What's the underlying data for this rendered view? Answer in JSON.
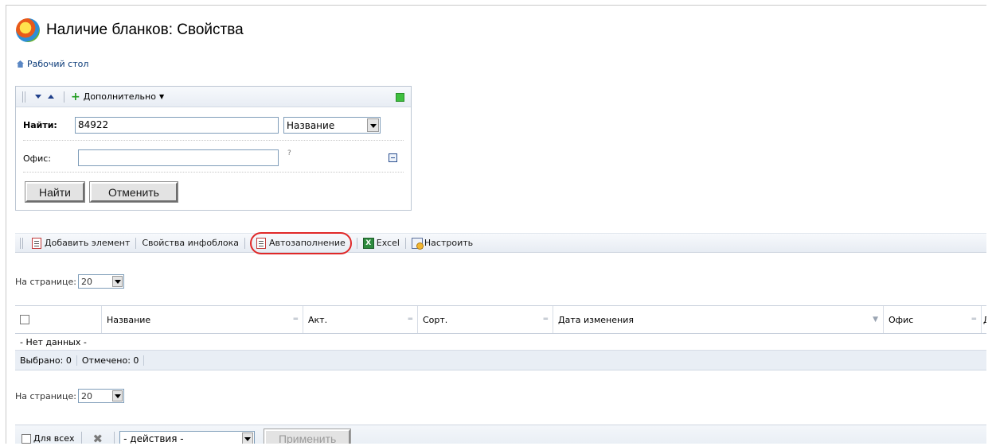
{
  "page": {
    "title": "Наличие бланков: Свойства",
    "breadcrumb": "Рабочий стол"
  },
  "filter": {
    "more_label": "Дополнительно",
    "find_label": "Найти:",
    "find_value": "84922",
    "find_scope": "Название",
    "office_label": "Офис:",
    "office_value": "",
    "hint": "?",
    "find_button": "Найти",
    "cancel_button": "Отменить"
  },
  "toolbar": {
    "add_element": "Добавить элемент",
    "iblock_properties": "Свойства инфоблока",
    "autofill": "Автозаполнение",
    "excel": "Excel",
    "settings": "Настроить",
    "highlight_color": "#e02828"
  },
  "pagination": {
    "per_page_label": "На странице:",
    "per_page_value": "20"
  },
  "grid": {
    "columns": [
      "Название",
      "Акт.",
      "Сорт.",
      "Дата изменения",
      "Офис",
      "Д"
    ],
    "empty_text": "- Нет данных -",
    "selected": "Выбрано: 0",
    "checked": "Отмечено: 0"
  },
  "actions": {
    "for_all": "Для всех",
    "action_select": "- действия -",
    "apply_button": "Применить"
  }
}
